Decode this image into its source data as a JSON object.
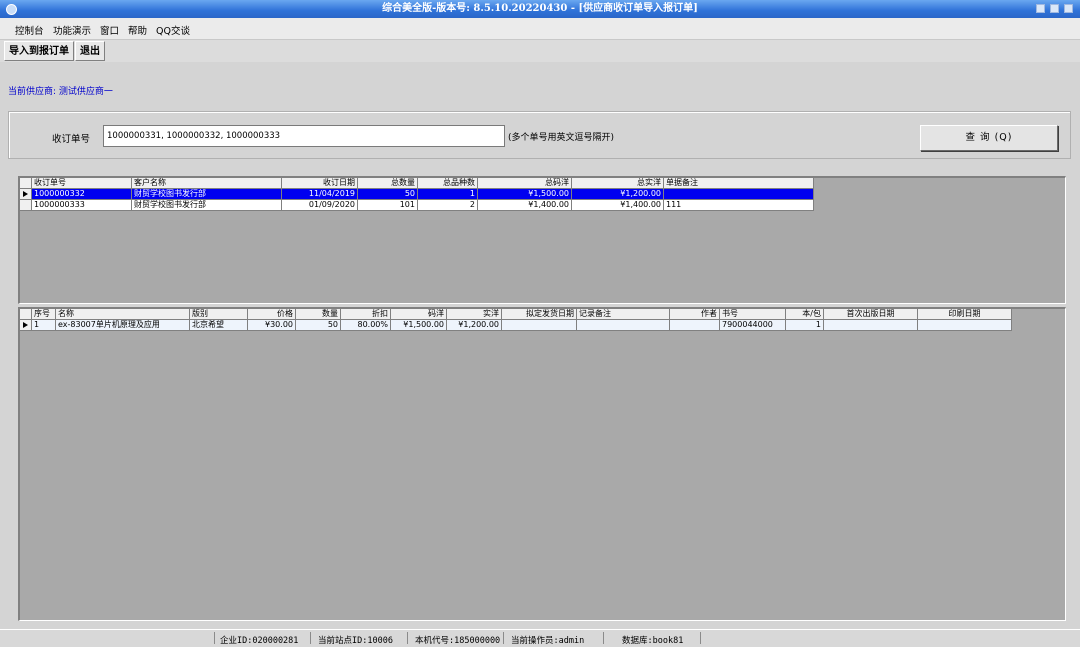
{
  "window": {
    "title": "综合美全版-版本号: 8.5.10.20220430 - [供应商收订单导入报订单]"
  },
  "menu": [
    "控制台",
    "功能演示",
    "窗口",
    "帮助",
    "QQ交谈"
  ],
  "toolbar": {
    "import_label": "导入到报订单",
    "exit_label": "退出"
  },
  "supplier_label": "当前供应商: 测试供应商一",
  "query": {
    "order_label": "收订单号",
    "order_value": "1000000331, 1000000332, 1000000333",
    "hint": "(多个单号用英文逗号隔开)",
    "button_label": "查 询 (Q)"
  },
  "orders": {
    "columns": [
      "收订单号",
      "客户名称",
      "收订日期",
      "总数量",
      "总品种数",
      "总码洋",
      "总实洋",
      "单据备注"
    ],
    "rows": [
      [
        "1000000332",
        "财贸学校图书发行部",
        "11/04/2019",
        "50",
        "1",
        "¥1,500.00",
        "¥1,200.00",
        ""
      ],
      [
        "1000000333",
        "财贸学校图书发行部",
        "01/09/2020",
        "101",
        "2",
        "¥1,400.00",
        "¥1,400.00",
        "111"
      ]
    ]
  },
  "details": {
    "columns": [
      "序号",
      "名称",
      "版别",
      "价格",
      "数量",
      "折扣",
      "码洋",
      "实洋",
      "拟定发货日期",
      "记录备注",
      "作者",
      "书号",
      "本/包",
      "首次出版日期",
      "印刷日期"
    ],
    "rows": [
      [
        "1",
        "ex-83007单片机原理及应用",
        "北京希望",
        "¥30.00",
        "50",
        "80.00%",
        "¥1,500.00",
        "¥1,200.00",
        "",
        "",
        "",
        "7900044000",
        "1",
        "",
        ""
      ]
    ]
  },
  "status": {
    "company": "企业ID:020000281",
    "site": "当前站点ID:10006",
    "machine": "本机代号:185000000",
    "operator": "当前操作员:admin",
    "database": "数据库:book81"
  }
}
